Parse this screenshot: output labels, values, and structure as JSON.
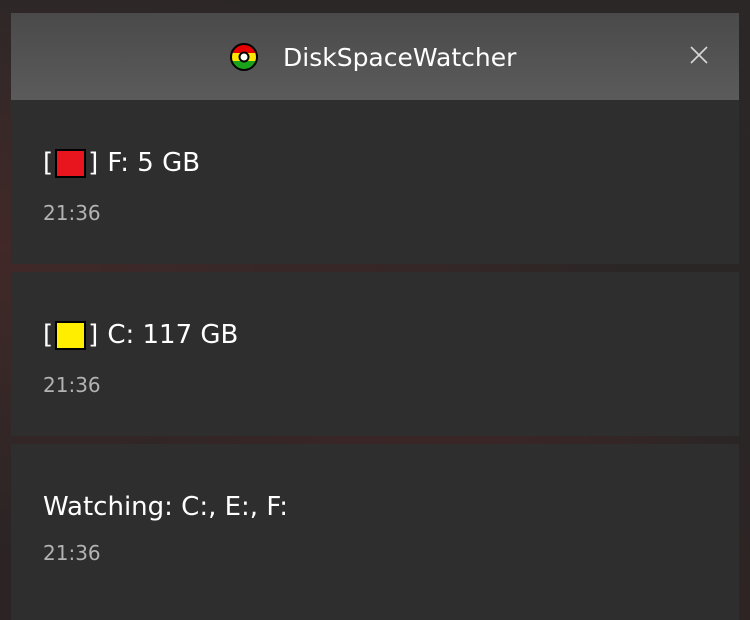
{
  "app": {
    "title": "DiskSpaceWatcher",
    "icon": "disk-ring-icon",
    "icon_colors": [
      "#e60000",
      "#ffe600",
      "#1aa31a"
    ]
  },
  "notifications": [
    {
      "open_bracket": "[",
      "swatch_color": "#e8141e",
      "close_bracket": "]",
      "text": "F: 5 GB",
      "time": "21:36"
    },
    {
      "open_bracket": "[",
      "swatch_color": "#ffee00",
      "close_bracket": "]",
      "text": "C: 117 GB",
      "time": "21:36"
    },
    {
      "text": "Watching: C:, E:, F:",
      "time": "21:36"
    }
  ]
}
